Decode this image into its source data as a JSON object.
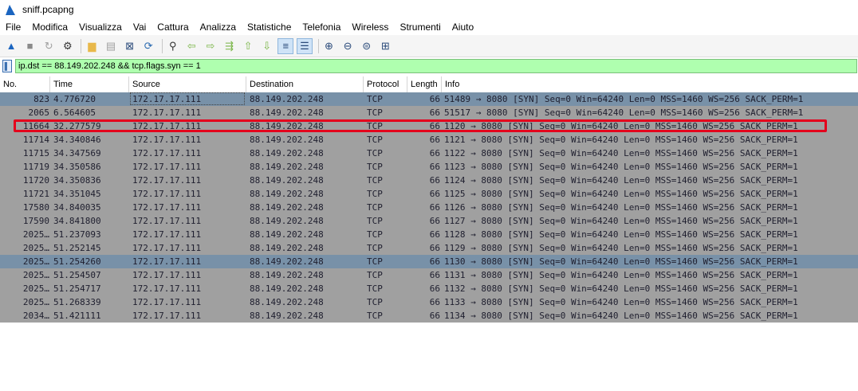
{
  "window": {
    "title": "sniff.pcapng"
  },
  "menu": [
    "File",
    "Modifica",
    "Visualizza",
    "Vai",
    "Cattura",
    "Analizza",
    "Statistiche",
    "Telefonia",
    "Wireless",
    "Strumenti",
    "Aiuto"
  ],
  "toolbar": [
    {
      "name": "start-capture-icon",
      "glyph": "▲",
      "color": "#1b65c0"
    },
    {
      "name": "stop-capture-icon",
      "glyph": "■",
      "color": "#8a8a8a"
    },
    {
      "name": "restart-capture-icon",
      "glyph": "↻",
      "color": "#a0a0a0"
    },
    {
      "name": "capture-options-icon",
      "glyph": "⚙",
      "color": "#333333"
    },
    {
      "sep": true
    },
    {
      "name": "open-file-icon",
      "glyph": "▆",
      "color": "#e8b84a"
    },
    {
      "name": "save-file-icon",
      "glyph": "▤",
      "color": "#a0a0a0"
    },
    {
      "name": "close-file-icon",
      "glyph": "⊠",
      "color": "#2a4a7a"
    },
    {
      "name": "reload-file-icon",
      "glyph": "⟳",
      "color": "#2a6ab0"
    },
    {
      "sep": true
    },
    {
      "name": "find-packet-icon",
      "glyph": "⚲",
      "color": "#333333"
    },
    {
      "name": "go-back-icon",
      "glyph": "⇦",
      "color": "#7ab648"
    },
    {
      "name": "go-forward-icon",
      "glyph": "⇨",
      "color": "#7ab648"
    },
    {
      "name": "go-to-packet-icon",
      "glyph": "⇶",
      "color": "#7ab648"
    },
    {
      "name": "first-packet-icon",
      "glyph": "⇧",
      "color": "#7ab648"
    },
    {
      "name": "last-packet-icon",
      "glyph": "⇩",
      "color": "#7ab648"
    },
    {
      "name": "autoscroll-icon",
      "glyph": "≡",
      "color": "#2a4a7a",
      "active": true
    },
    {
      "name": "colorize-icon",
      "glyph": "☰",
      "color": "#2a4a7a",
      "active": true
    },
    {
      "sep": true
    },
    {
      "name": "zoom-in-icon",
      "glyph": "⊕",
      "color": "#2a4a7a"
    },
    {
      "name": "zoom-out-icon",
      "glyph": "⊖",
      "color": "#2a4a7a"
    },
    {
      "name": "normal-size-icon",
      "glyph": "⊜",
      "color": "#2a4a7a"
    },
    {
      "name": "resize-columns-icon",
      "glyph": "⊞",
      "color": "#2a4a7a"
    }
  ],
  "filter": {
    "value": "ip.dst == 88.149.202.248 && tcp.flags.syn == 1"
  },
  "columns": [
    "No.",
    "Time",
    "Source",
    "Destination",
    "Protocol",
    "Length",
    "Info"
  ],
  "packets": [
    {
      "no": "823",
      "time": "4.776720",
      "src": "172.17.17.111",
      "dst": "88.149.202.248",
      "proto": "TCP",
      "len": "66",
      "info": "51489 → 8080 [SYN] Seq=0 Win=64240 Len=0 MSS=1460 WS=256 SACK_PERM=1",
      "selected": true
    },
    {
      "no": "2065",
      "time": "6.564605",
      "src": "172.17.17.111",
      "dst": "88.149.202.248",
      "proto": "TCP",
      "len": "66",
      "info": "51517 → 8080 [SYN] Seq=0 Win=64240 Len=0 MSS=1460 WS=256 SACK_PERM=1"
    },
    {
      "no": "11664",
      "time": "32.277579",
      "src": "172.17.17.111",
      "dst": "88.149.202.248",
      "proto": "TCP",
      "len": "66",
      "info": "1120 → 8080 [SYN] Seq=0 Win=64240 Len=0 MSS=1460 WS=256 SACK_PERM=1",
      "highlighted": true
    },
    {
      "no": "11714",
      "time": "34.340846",
      "src": "172.17.17.111",
      "dst": "88.149.202.248",
      "proto": "TCP",
      "len": "66",
      "info": "1121 → 8080 [SYN] Seq=0 Win=64240 Len=0 MSS=1460 WS=256 SACK_PERM=1"
    },
    {
      "no": "11715",
      "time": "34.347569",
      "src": "172.17.17.111",
      "dst": "88.149.202.248",
      "proto": "TCP",
      "len": "66",
      "info": "1122 → 8080 [SYN] Seq=0 Win=64240 Len=0 MSS=1460 WS=256 SACK_PERM=1"
    },
    {
      "no": "11719",
      "time": "34.350586",
      "src": "172.17.17.111",
      "dst": "88.149.202.248",
      "proto": "TCP",
      "len": "66",
      "info": "1123 → 8080 [SYN] Seq=0 Win=64240 Len=0 MSS=1460 WS=256 SACK_PERM=1"
    },
    {
      "no": "11720",
      "time": "34.350836",
      "src": "172.17.17.111",
      "dst": "88.149.202.248",
      "proto": "TCP",
      "len": "66",
      "info": "1124 → 8080 [SYN] Seq=0 Win=64240 Len=0 MSS=1460 WS=256 SACK_PERM=1"
    },
    {
      "no": "11721",
      "time": "34.351045",
      "src": "172.17.17.111",
      "dst": "88.149.202.248",
      "proto": "TCP",
      "len": "66",
      "info": "1125 → 8080 [SYN] Seq=0 Win=64240 Len=0 MSS=1460 WS=256 SACK_PERM=1"
    },
    {
      "no": "17580",
      "time": "34.840035",
      "src": "172.17.17.111",
      "dst": "88.149.202.248",
      "proto": "TCP",
      "len": "66",
      "info": "1126 → 8080 [SYN] Seq=0 Win=64240 Len=0 MSS=1460 WS=256 SACK_PERM=1"
    },
    {
      "no": "17590",
      "time": "34.841800",
      "src": "172.17.17.111",
      "dst": "88.149.202.248",
      "proto": "TCP",
      "len": "66",
      "info": "1127 → 8080 [SYN] Seq=0 Win=64240 Len=0 MSS=1460 WS=256 SACK_PERM=1"
    },
    {
      "no": "2025…",
      "time": "51.237093",
      "src": "172.17.17.111",
      "dst": "88.149.202.248",
      "proto": "TCP",
      "len": "66",
      "info": "1128 → 8080 [SYN] Seq=0 Win=64240 Len=0 MSS=1460 WS=256 SACK_PERM=1"
    },
    {
      "no": "2025…",
      "time": "51.252145",
      "src": "172.17.17.111",
      "dst": "88.149.202.248",
      "proto": "TCP",
      "len": "66",
      "info": "1129 → 8080 [SYN] Seq=0 Win=64240 Len=0 MSS=1460 WS=256 SACK_PERM=1"
    },
    {
      "no": "2025…",
      "time": "51.254260",
      "src": "172.17.17.111",
      "dst": "88.149.202.248",
      "proto": "TCP",
      "len": "66",
      "info": "1130 → 8080 [SYN] Seq=0 Win=64240 Len=0 MSS=1460 WS=256 SACK_PERM=1",
      "selected": true
    },
    {
      "no": "2025…",
      "time": "51.254507",
      "src": "172.17.17.111",
      "dst": "88.149.202.248",
      "proto": "TCP",
      "len": "66",
      "info": "1131 → 8080 [SYN] Seq=0 Win=64240 Len=0 MSS=1460 WS=256 SACK_PERM=1"
    },
    {
      "no": "2025…",
      "time": "51.254717",
      "src": "172.17.17.111",
      "dst": "88.149.202.248",
      "proto": "TCP",
      "len": "66",
      "info": "1132 → 8080 [SYN] Seq=0 Win=64240 Len=0 MSS=1460 WS=256 SACK_PERM=1"
    },
    {
      "no": "2025…",
      "time": "51.268339",
      "src": "172.17.17.111",
      "dst": "88.149.202.248",
      "proto": "TCP",
      "len": "66",
      "info": "1133 → 8080 [SYN] Seq=0 Win=64240 Len=0 MSS=1460 WS=256 SACK_PERM=1"
    },
    {
      "no": "2034…",
      "time": "51.421111",
      "src": "172.17.17.111",
      "dst": "88.149.202.248",
      "proto": "TCP",
      "len": "66",
      "info": "1134 → 8080 [SYN] Seq=0 Win=64240 Len=0 MSS=1460 WS=256 SACK_PERM=1"
    }
  ],
  "colors": {
    "row_bg": "#a0a0a0",
    "row_selected_bg": "#7891a8",
    "filter_bg": "#afffaf",
    "highlight_border": "#e4001c",
    "brand": "#1b65c0"
  }
}
